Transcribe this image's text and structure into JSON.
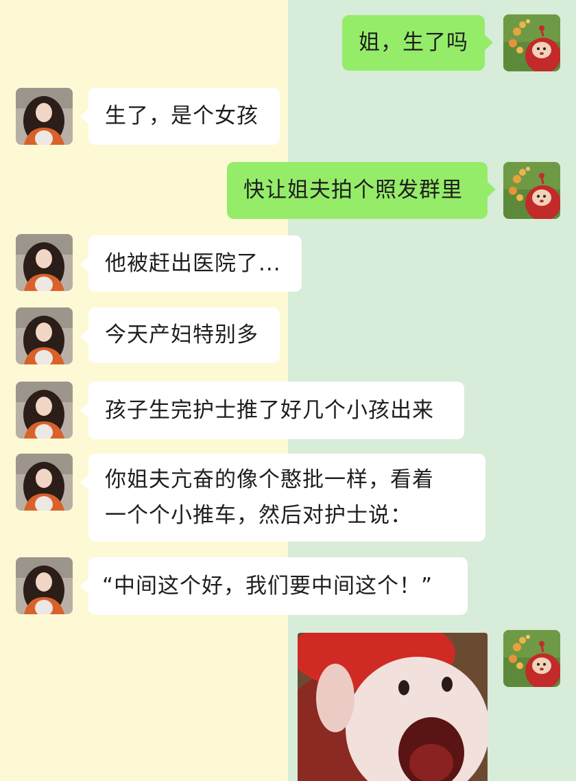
{
  "chat": {
    "messages": [
      {
        "side": "right",
        "text": "姐，生了吗"
      },
      {
        "side": "left",
        "text": "生了，是个女孩"
      },
      {
        "side": "right",
        "text": "快让姐夫拍个照发群里"
      },
      {
        "side": "left",
        "text": "他被赶出医院了..."
      },
      {
        "side": "left",
        "text": "今天产妇特别多"
      },
      {
        "side": "left",
        "text": "孩子生完护士推了好几个小孩出来"
      },
      {
        "side": "left",
        "text": "你姐夫亢奋的像个憨批一样，看着\n一个个小推车，然后对护士说："
      },
      {
        "side": "left",
        "text": "“中间这个好，我们要中间这个！”"
      }
    ],
    "sticker": {
      "icon": "screaming-creature-sticker"
    }
  },
  "avatars": {
    "self": {
      "icon": "red-teletubby-avatar"
    },
    "sister": {
      "icon": "girl-photo-avatar"
    }
  },
  "colors": {
    "left_background": "#fdf9d5",
    "right_background": "#d7ecd9",
    "sent_bubble": "#95ec69",
    "received_bubble": "#ffffff"
  }
}
